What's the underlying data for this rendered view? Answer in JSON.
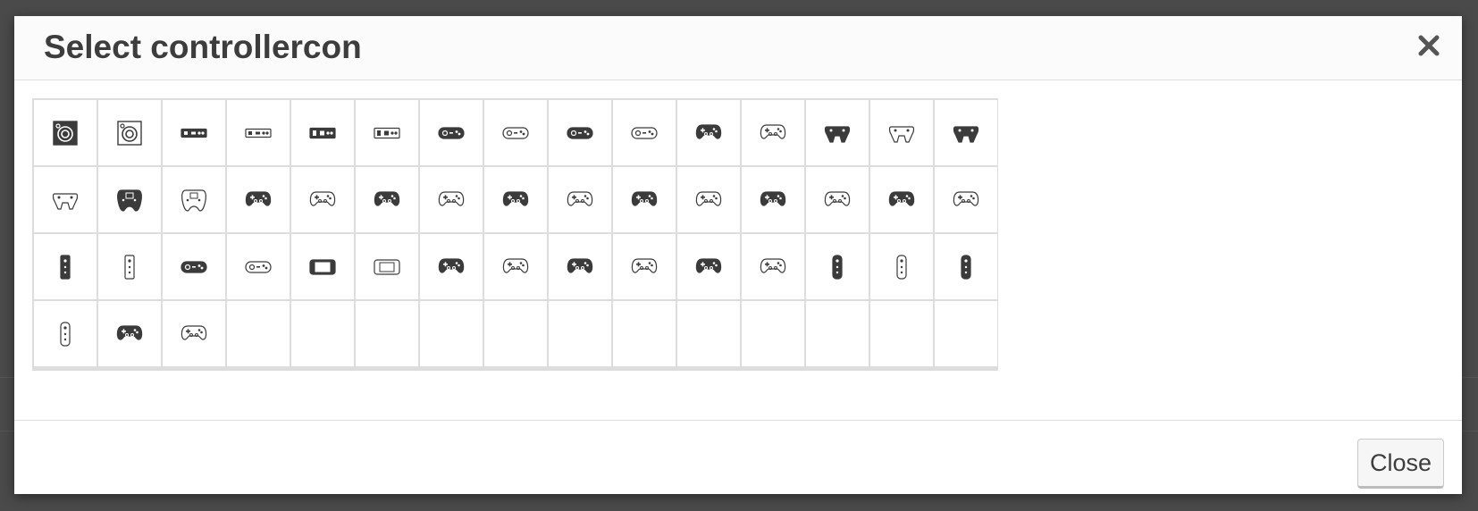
{
  "modal": {
    "title": "Select controllercon",
    "close_button_label": "Close",
    "close_x_icon": "close-x-icon"
  },
  "icons": [
    {
      "name": "speaker-filled-icon",
      "style": "filled"
    },
    {
      "name": "speaker-outline-icon",
      "style": "outline"
    },
    {
      "name": "famicom-filled-icon",
      "style": "filled"
    },
    {
      "name": "famicom-outline-icon",
      "style": "outline"
    },
    {
      "name": "nes-filled-icon",
      "style": "filled"
    },
    {
      "name": "nes-outline-icon",
      "style": "outline"
    },
    {
      "name": "genesis-filled-icon",
      "style": "filled"
    },
    {
      "name": "genesis-outline-icon",
      "style": "outline"
    },
    {
      "name": "snes-filled-icon",
      "style": "filled"
    },
    {
      "name": "snes-outline-icon",
      "style": "outline"
    },
    {
      "name": "playstation-filled-icon",
      "style": "filled"
    },
    {
      "name": "playstation-outline-icon",
      "style": "outline"
    },
    {
      "name": "n64-front-filled-icon",
      "style": "filled"
    },
    {
      "name": "n64-front-outline-icon",
      "style": "outline"
    },
    {
      "name": "n64-filled-icon",
      "style": "filled"
    },
    {
      "name": "n64-outline-icon",
      "style": "outline"
    },
    {
      "name": "dreamcast-filled-icon",
      "style": "filled"
    },
    {
      "name": "dreamcast-outline-icon",
      "style": "outline"
    },
    {
      "name": "ps2-filled-icon",
      "style": "filled"
    },
    {
      "name": "ps2-outline-icon",
      "style": "outline"
    },
    {
      "name": "xbox-duke-filled-icon",
      "style": "filled"
    },
    {
      "name": "xbox-duke-outline-icon",
      "style": "outline"
    },
    {
      "name": "xbox-s-filled-icon",
      "style": "filled"
    },
    {
      "name": "xbox-s-outline-icon",
      "style": "outline"
    },
    {
      "name": "gamecube-filled-icon",
      "style": "filled"
    },
    {
      "name": "gamecube-outline-icon",
      "style": "outline"
    },
    {
      "name": "xbox360-filled-icon",
      "style": "filled"
    },
    {
      "name": "xbox360-outline-icon",
      "style": "outline"
    },
    {
      "name": "ps3-filled-icon",
      "style": "filled"
    },
    {
      "name": "ps3-outline-icon",
      "style": "outline"
    },
    {
      "name": "wii-remote-filled-icon",
      "style": "filled"
    },
    {
      "name": "wii-remote-outline-icon",
      "style": "outline"
    },
    {
      "name": "wii-classic-filled-icon",
      "style": "filled"
    },
    {
      "name": "wii-classic-outline-icon",
      "style": "outline"
    },
    {
      "name": "wii-u-gamepad-filled-icon",
      "style": "filled"
    },
    {
      "name": "wii-u-gamepad-outline-icon",
      "style": "outline"
    },
    {
      "name": "xbox-one-filled-icon",
      "style": "filled"
    },
    {
      "name": "xbox-one-outline-icon",
      "style": "outline"
    },
    {
      "name": "ps4-filled-icon",
      "style": "filled"
    },
    {
      "name": "ps4-outline-icon",
      "style": "outline"
    },
    {
      "name": "xbox-series-filled-icon",
      "style": "filled"
    },
    {
      "name": "xbox-series-outline-icon",
      "style": "outline"
    },
    {
      "name": "joycon-left-filled-icon",
      "style": "filled"
    },
    {
      "name": "joycon-left-outline-icon",
      "style": "outline"
    },
    {
      "name": "joycon-right-filled-icon",
      "style": "filled"
    },
    {
      "name": "joycon-right-outline-icon",
      "style": "outline"
    },
    {
      "name": "switch-pro-filled-icon",
      "style": "filled"
    },
    {
      "name": "switch-pro-outline-icon",
      "style": "outline"
    }
  ],
  "grid": {
    "columns": 15,
    "total_cells": 60
  },
  "colors": {
    "backdrop": "#4a4a4a",
    "icon": "#3b3b3b",
    "border": "#dddddd",
    "title": "#3d3d3d"
  }
}
